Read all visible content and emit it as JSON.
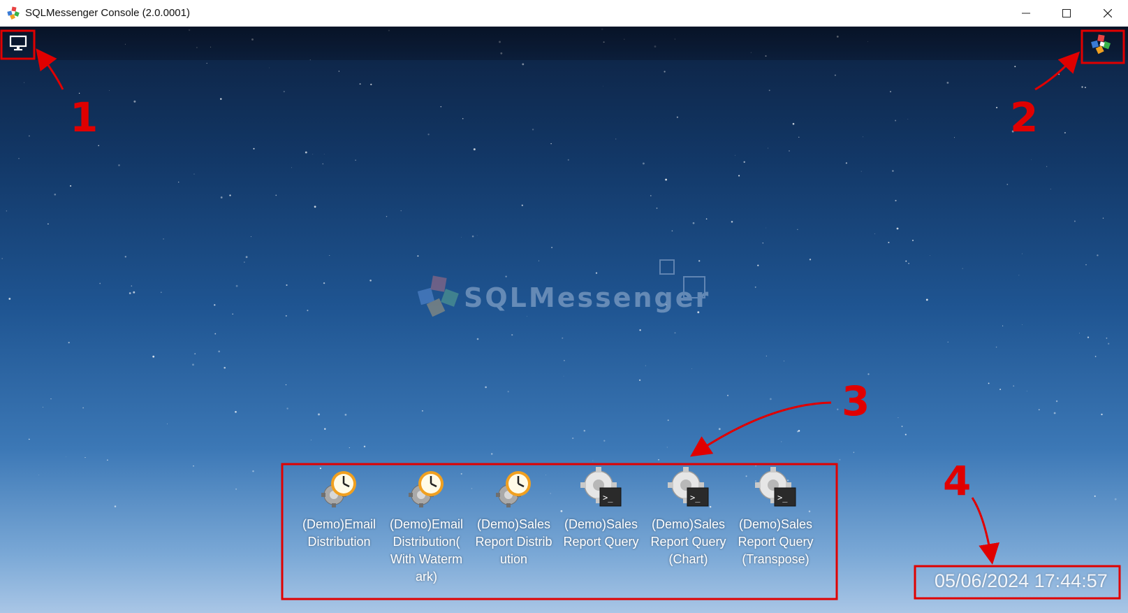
{
  "window": {
    "title": "SQLMessenger Console (2.0.0001)",
    "controls": {
      "minimize": "—",
      "maximize": "☐",
      "close": "✕"
    }
  },
  "toolbar": {
    "left_icon": "monitor-icon",
    "right_icon": "app-menu-icon"
  },
  "watermark": {
    "text": "SQLMessenger"
  },
  "shortcuts": [
    {
      "label": "(Demo)Email Distribution",
      "icon": "scheduled-task-icon"
    },
    {
      "label": "(Demo)Email Distribution( With Watermark)",
      "icon": "scheduled-task-icon"
    },
    {
      "label": "(Demo)Sales Report Distribution",
      "icon": "scheduled-task-icon"
    },
    {
      "label": "(Demo)Sales Report Query",
      "icon": "query-task-icon"
    },
    {
      "label": "(Demo)Sales Report Query(Chart)",
      "icon": "query-task-icon"
    },
    {
      "label": "(Demo)Sales Report Query(Transpose)",
      "icon": "query-task-icon"
    }
  ],
  "clock": {
    "datetime": "05/06/2024 17:44:57"
  },
  "annotations": {
    "labels": [
      "1",
      "2",
      "3",
      "4"
    ],
    "color": "#e00000"
  }
}
